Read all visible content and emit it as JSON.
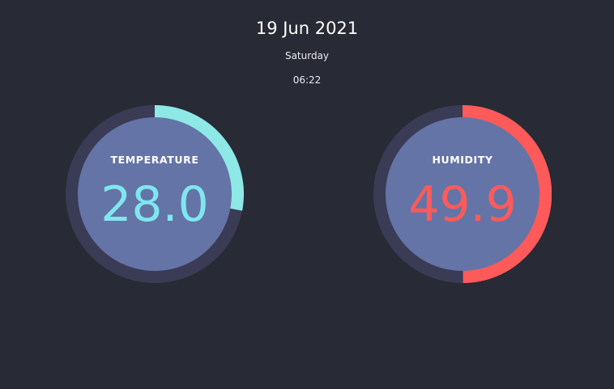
{
  "header": {
    "date": "19 Jun 2021",
    "weekday": "Saturday",
    "time": "06:22"
  },
  "gauges": [
    {
      "label": "TEMPERATURE",
      "value": "28.0",
      "fill_fraction": 0.28,
      "color": "#8de8e6",
      "value_color": "#7fe6f0"
    },
    {
      "label": "HUMIDITY",
      "value": "49.9",
      "fill_fraction": 0.499,
      "color": "#ff5a5a",
      "value_color": "#ff5a5a"
    }
  ],
  "colors": {
    "background": "#282a35",
    "track": "#3a3b55",
    "inner": "#6474a6"
  }
}
